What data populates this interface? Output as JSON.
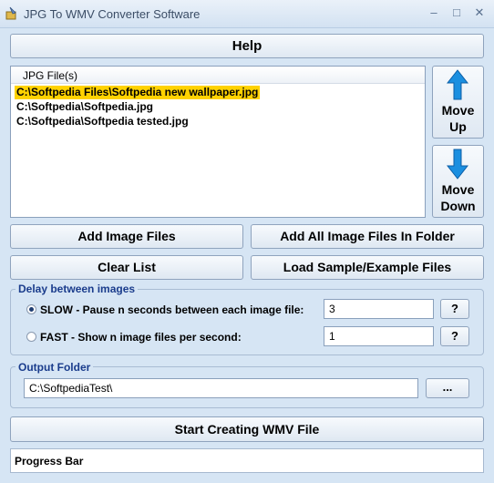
{
  "window": {
    "title": "JPG To WMV Converter Software"
  },
  "toolbar": {
    "help_label": "Help"
  },
  "file_list": {
    "header": "JPG File(s)",
    "items": [
      {
        "path": "C:\\Softpedia Files\\Softpedia new wallpaper.jpg",
        "selected": true
      },
      {
        "path": "C:\\Softpedia\\Softpedia.jpg",
        "selected": false
      },
      {
        "path": "C:\\Softpedia\\Softpedia tested.jpg",
        "selected": false
      }
    ]
  },
  "move": {
    "up_line1": "Move",
    "up_line2": "Up",
    "down_line1": "Move",
    "down_line2": "Down"
  },
  "actions": {
    "add_files": "Add Image Files",
    "add_folder": "Add All Image Files In Folder",
    "clear_list": "Clear List",
    "load_sample": "Load Sample/Example Files"
  },
  "delay": {
    "legend": "Delay between images",
    "slow_label": "SLOW - Pause n seconds between each image file:",
    "slow_value": "3",
    "fast_label": "FAST - Show n image files per second:",
    "fast_value": "1",
    "help_btn": "?",
    "selected_mode": "slow"
  },
  "output": {
    "legend": "Output Folder",
    "path": "C:\\SoftpediaTest\\",
    "browse_label": "..."
  },
  "start_label": "Start Creating WMV File",
  "progress": {
    "label": "Progress Bar"
  },
  "colors": {
    "accent_arrow": "#1b8fe0",
    "selection": "#ffd200",
    "background": "#d6e5f4"
  },
  "icons": {
    "app": "app-icon",
    "up": "arrow-up-icon",
    "down": "arrow-down-icon"
  }
}
